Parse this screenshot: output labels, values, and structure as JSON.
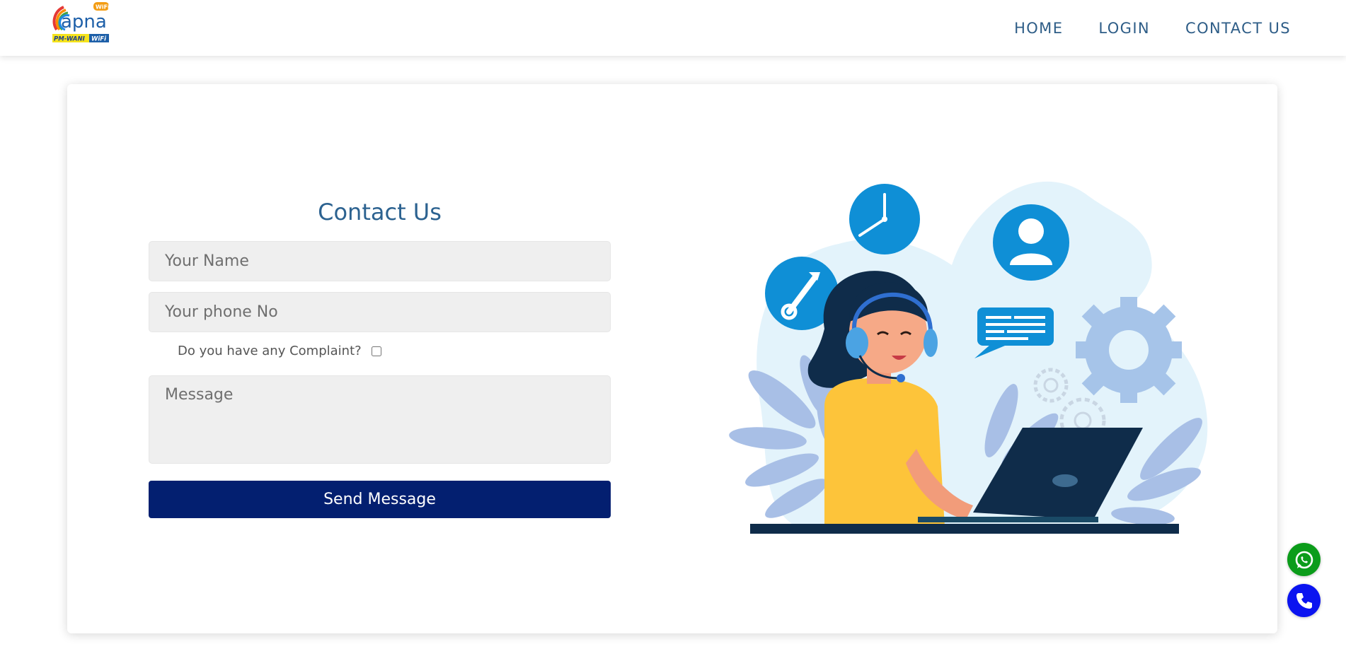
{
  "brand": {
    "logo_word": "apna",
    "logo_badge": "PM-WANI",
    "logo_wifi": "WiFi",
    "logo_tag": "WiFi"
  },
  "nav": {
    "items": [
      {
        "label": "HOME"
      },
      {
        "label": "LOGIN"
      },
      {
        "label": "CONTACT US"
      }
    ]
  },
  "form": {
    "title": "Contact Us",
    "name_placeholder": "Your Name",
    "phone_placeholder": "Your phone No",
    "complaint_label": "Do you have any Complaint?",
    "complaint_checked": false,
    "message_placeholder": "Message",
    "submit_label": "Send Message"
  },
  "floating": {
    "whatsapp_icon": "whatsapp-icon",
    "call_icon": "phone-icon"
  },
  "colors": {
    "nav_text": "#2e5d87",
    "title": "#2c6290",
    "button": "#031f70",
    "whatsapp": "#0b9c1a",
    "call": "#0b14f0"
  }
}
